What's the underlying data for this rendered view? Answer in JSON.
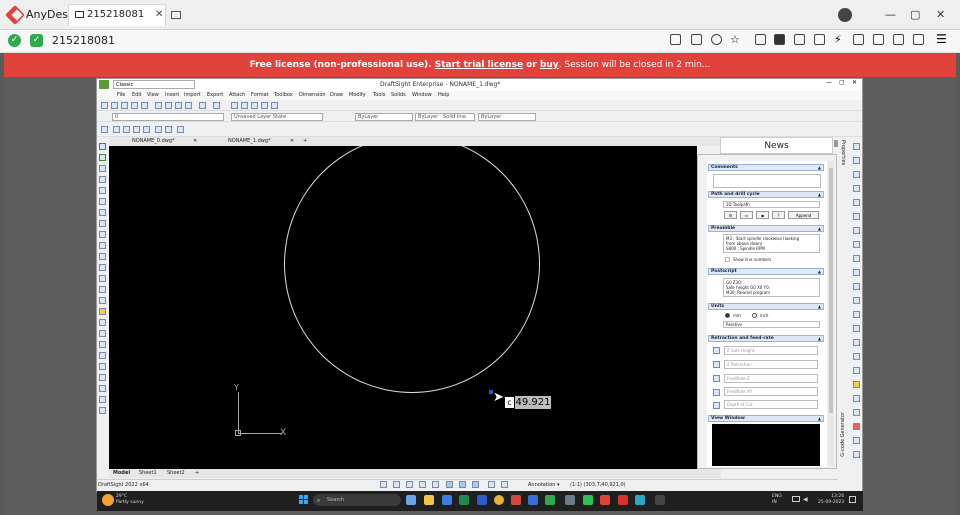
{
  "anydesk": {
    "app_name": "AnyDesk",
    "tab_label": "215218081",
    "session_id": "215218081",
    "window_controls": [
      "—",
      "▢",
      "✕"
    ]
  },
  "banner": {
    "prefix": "Free license (non-professional use). ",
    "trial_link": "Start trial license",
    "or": " or ",
    "buy_link": "buy",
    "suffix": ". Session will be closed in 2 min..."
  },
  "draftsight": {
    "title": "DraftSight Enterprise - NONAME_1.dwg*",
    "workspace": "Classic",
    "menu": [
      "File",
      "Edit",
      "View",
      "Insert",
      "Import",
      "Export",
      "Attach",
      "Format",
      "Toolbox",
      "Dimension",
      "Draw",
      "Modify",
      "Tools",
      "Solids",
      "Window",
      "Help"
    ],
    "layer_state": "Unsaved Layer State",
    "layer_combo": "0",
    "bylayer_1": "ByLayer",
    "bylayer_2": "ByLayer",
    "linestyle": "Solid line",
    "lineweight": "ByLayer",
    "doc_tabs": [
      "NONAME_0.dwg*",
      "NONAME_1.dwg*"
    ],
    "model_tabs": [
      "Model",
      "Sheet1",
      "Sheet2"
    ],
    "version": "DraftSight 2022 x64",
    "annotation": "Annotation",
    "scale": "(1:1)",
    "coords": "(303,7,40,921,0)",
    "tooltip_value": "49.921",
    "ucs_x": "X",
    "ucs_y": "Y",
    "properties_label": "Properties",
    "gcode_label": "G-code Generator"
  },
  "news": {
    "title": "News",
    "comments": "Comments",
    "path": "Path and drill cycle",
    "toolpath": "2D Toolpath",
    "append": "Append",
    "preamble": "Preamble",
    "pre_lines": [
      "M3 ; Start spindle clockwise (looking",
      "from above down)",
      "S800 ; Spindle RPM"
    ],
    "show_line_numbers": "Show line numbers",
    "postscript": "Postscript",
    "post_lines": [
      "G0 Z30;",
      "Safe height G0 X0 Y0;",
      "M30; Rewind program"
    ],
    "units": "Units",
    "mm": "mm",
    "inch": "inch",
    "relative": "Relative",
    "retraction": "Retraction and feed-rate",
    "fields": [
      "Z Safe Height",
      "Z Retraction",
      "FeedRate Z",
      "FeedRate XY",
      "Depth of Cut"
    ],
    "view_window": "View Window"
  },
  "taskbar": {
    "weather_temp": "29°C",
    "weather_desc": "Partly sunny",
    "search_placeholder": "Search",
    "lang": "ENG",
    "region": "IN",
    "time": "13:26",
    "date": "25-09-2023"
  }
}
